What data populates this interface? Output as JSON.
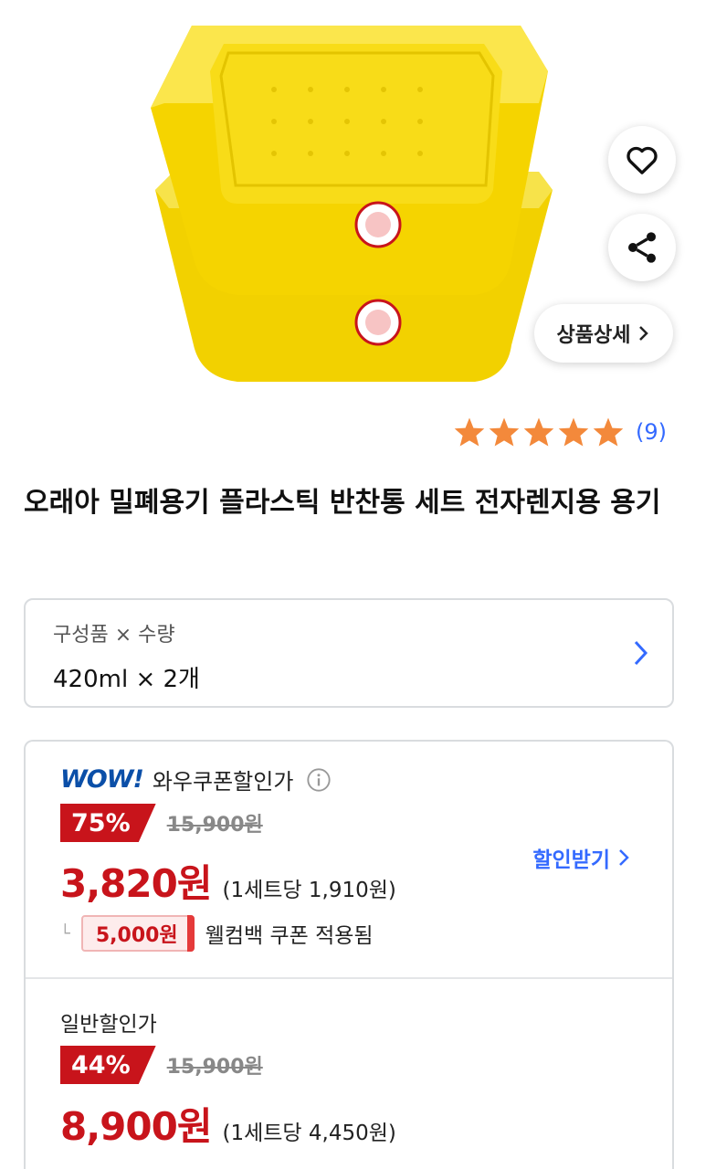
{
  "product": {
    "title": "오래아 밀폐용기 플라스틱 반찬통 세트 전자렌지용 용기",
    "image_alt": "yellow plastic container set",
    "colors": {
      "accent_red": "#c8141b",
      "link_blue": "#346aff",
      "star_orange": "#f3893b",
      "wow_blue": "#0b4fa8"
    }
  },
  "actions": {
    "like_icon": "heart-icon",
    "share_icon": "share-icon",
    "detail_label": "상품상세"
  },
  "rating": {
    "stars": 5,
    "count_text": "(9)"
  },
  "option": {
    "label": "구성품 × 수량",
    "value": "420ml × 2개"
  },
  "wow": {
    "logo": "WOW!",
    "label": "와우쿠폰할인가",
    "discount": "75%",
    "original_price": "15,900원",
    "final_price": "3,820원",
    "unit_price": "(1세트당 1,910원)",
    "coupon_button": "할인받기",
    "cashback_amount": "5,000원",
    "cashback_text": "웰컴백 쿠폰 적용됨"
  },
  "normal": {
    "label": "일반할인가",
    "discount": "44%",
    "original_price": "15,900원",
    "final_price": "8,900원",
    "unit_price": "(1세트당 4,450원)"
  }
}
